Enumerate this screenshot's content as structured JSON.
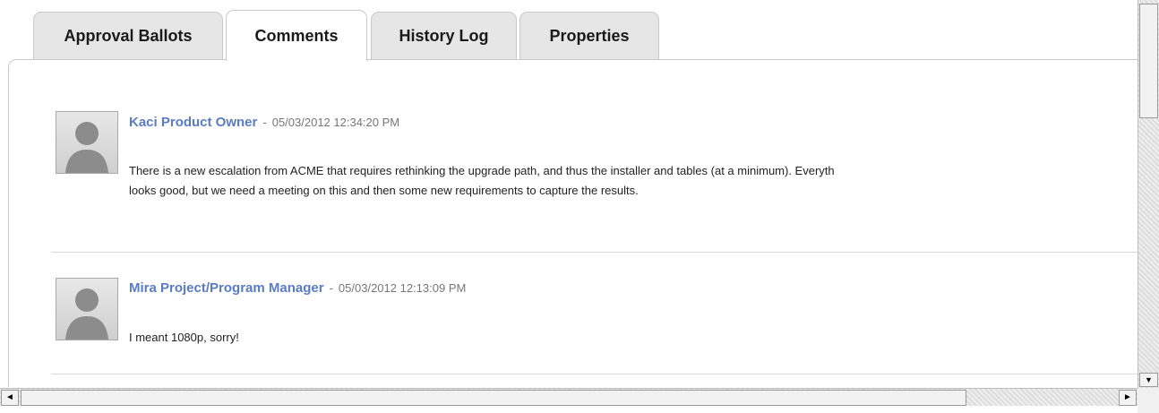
{
  "tabs": [
    {
      "label": "Approval Ballots",
      "active": false
    },
    {
      "label": "Comments",
      "active": true
    },
    {
      "label": "History Log",
      "active": false
    },
    {
      "label": "Properties",
      "active": false
    }
  ],
  "comments": [
    {
      "author": "Kaci Product Owner",
      "separator": "-",
      "timestamp": "05/03/2012 12:34:20 PM",
      "body_lines": [
        "There is a new escalation from ACME that requires rethinking the upgrade path, and thus the installer and tables (at a minimum). Everyth",
        "looks good, but we need a meeting on this and then some new requirements to capture the results."
      ]
    },
    {
      "author": "Mira Project/Program Manager",
      "separator": "-",
      "timestamp": "05/03/2012 12:13:09 PM",
      "body_lines": [
        "I meant 1080p, sorry!"
      ]
    }
  ],
  "scrollbars": {
    "vertical_down_glyph": "▼",
    "left_glyph": "◄",
    "right_glyph": "►"
  },
  "colors": {
    "author_link": "#5a7cc6",
    "timestamp": "#777777",
    "tab_inactive_bg": "#e6e6e6"
  }
}
